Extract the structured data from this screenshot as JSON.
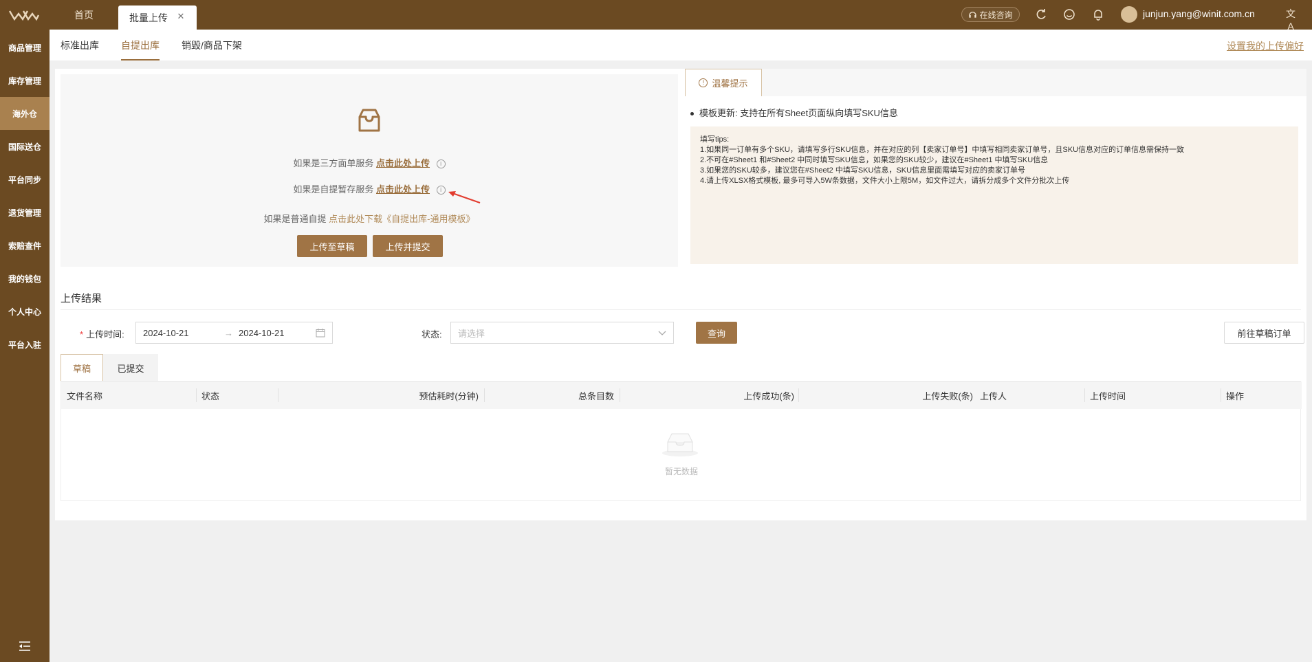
{
  "topbar": {
    "tabs": [
      {
        "label": "首页"
      },
      {
        "label": "批量上传"
      }
    ],
    "close_glyph": "✕",
    "consult_label": "在线咨询",
    "user_email": "junjun.yang@winit.com.cn",
    "lang_glyph": "文A",
    "icons": [
      "logo-icon",
      "refresh-icon",
      "smile-icon",
      "bell-icon",
      "avatar",
      "translate-icon"
    ]
  },
  "sidebar": {
    "items": [
      {
        "label": "商品管理"
      },
      {
        "label": "库存管理"
      },
      {
        "label": "海外仓",
        "active": true
      },
      {
        "label": "国际送仓"
      },
      {
        "label": "平台同步"
      },
      {
        "label": "退货管理"
      },
      {
        "label": "索赔查件"
      },
      {
        "label": "我的钱包"
      },
      {
        "label": "个人中心"
      },
      {
        "label": "平台入驻"
      }
    ]
  },
  "subnav": {
    "tabs": [
      {
        "label": "标准出库"
      },
      {
        "label": "自提出库",
        "active": true
      },
      {
        "label": "销毁/商品下架"
      }
    ],
    "pref_link": "设置我的上传偏好"
  },
  "upload": {
    "line1_prefix": "如果是三方面单服务",
    "line1_link": "点击此处上传",
    "line2_prefix": "如果是自提暂存服务",
    "line2_link": "点击此处上传",
    "line3_prefix": "如果是普通自提",
    "line3_link": "点击此处下载《自提出库-通用模板》",
    "btn_draft": "上传至草稿",
    "btn_submit": "上传并提交"
  },
  "tips": {
    "tab_label": "温馨提示",
    "headline": "模板更新: 支持在所有Sheet页面纵向填写SKU信息",
    "title": "填写tips:",
    "lines": [
      "1.如果同一订单有多个SKU，请填写多行SKU信息，并在对应的列【卖家订单号】中填写相同卖家订单号，且SKU信息对应的订单信息需保持一致",
      "2.不可在#Sheet1 和#Sheet2 中同时填写SKU信息，如果您的SKU较少，建议在#Sheet1 中填写SKU信息",
      "3.如果您的SKU较多，建议您在#Sheet2 中填写SKU信息，SKU信息里面需填写对应的卖家订单号",
      "4.请上传XLSX格式模板, 最多可导入5W条数据，文件大小上限5M，如文件过大，请拆分成多个文件分批次上传"
    ]
  },
  "result": {
    "title": "上传结果",
    "upload_time_label": "上传时间:",
    "date_start": "2024-10-21",
    "date_end": "2024-10-21",
    "date_arrow": "→",
    "status_label": "状态:",
    "status_placeholder": "请选择",
    "query_btn": "查询",
    "goto_btn": "前往草稿订单",
    "tabs": [
      {
        "label": "草稿",
        "active": true
      },
      {
        "label": "已提交"
      }
    ],
    "columns": [
      "文件名称",
      "状态",
      "预估耗时(分钟)",
      "总条目数",
      "上传成功(条)",
      "上传失败(条)",
      "上传人",
      "上传时间",
      "操作"
    ],
    "empty_text": "暂无数据"
  },
  "colors": {
    "brand": "#6b4a22",
    "accent": "#a07445",
    "sidebar_active": "#a9814f"
  }
}
